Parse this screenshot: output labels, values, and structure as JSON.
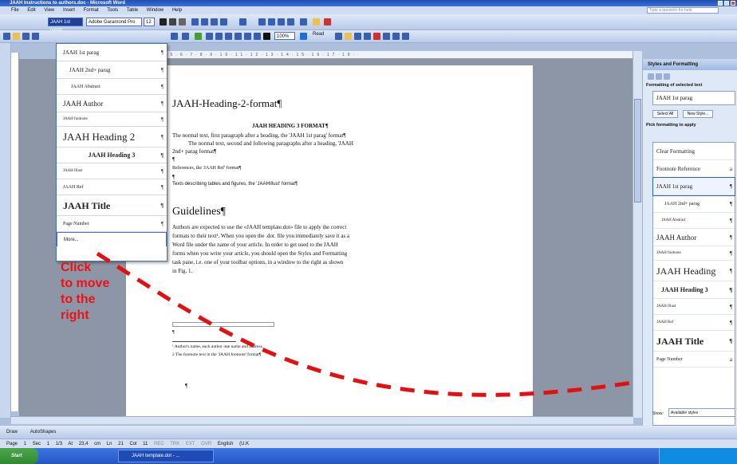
{
  "window": {
    "title": "JAAH Instructions to authors.doc - Microsoft Word"
  },
  "menu": {
    "items": [
      "File",
      "Edit",
      "View",
      "Insert",
      "Format",
      "Tools",
      "Table",
      "Window",
      "Help"
    ],
    "question_placeholder": "Type a question for help"
  },
  "toolbar": {
    "style_value": "JAAH 1st parag",
    "font_value": "Adobe Garamond Pro",
    "size_value": "12",
    "zoom_value": "100%",
    "read_label": "Read"
  },
  "dropdown": {
    "items": [
      {
        "label": "JAAH 1st parag"
      },
      {
        "label": "JAAH 2nd+ parag"
      },
      {
        "label": "JAAH Abstract"
      },
      {
        "label": "JAAH Author"
      },
      {
        "label": "JAAH footnote"
      },
      {
        "label": "JAAH Heading 2"
      },
      {
        "label": "JAAH Heading 3"
      },
      {
        "label": "JAAH Illust"
      },
      {
        "label": "JAAH Ref"
      },
      {
        "label": "JAAH Title"
      },
      {
        "label": "Page Number"
      },
      {
        "label": "More..."
      }
    ]
  },
  "document": {
    "heading2": "JAAH-Heading-2-format¶",
    "heading3": "JAAH HEADING 3 FORMAT¶",
    "p1": "The normal text, first paragraph after a heading, the 'JAAH 1st parag' format¶",
    "p2a": "The normal text, second and following paragraphs after a heading, 'JAAH",
    "p2b": "2nd+ parag format¶",
    "pilcrow": "¶",
    "ref_line": "References, the 'JAAH Ref' format¶",
    "illust_line": "Texts describing tables and figures, the 'JAAHIllust' format¶",
    "guidelines": "Guidelines¶",
    "g1": "Authors are expected to use the «JAAH template.dot» file to apply the correct",
    "g2": "formats to their text¹. When you open the .dot. file you immediately save it as a",
    "g3": "Word file under the name of your article. In order to get used to the JAAH",
    "g4": "forms when you write your article, you should open the Styles and Formatting",
    "g5": "task pane, i.e. one of your toolbar options, in a window to the right as shown",
    "g6": "in Fig. 1.",
    "fn1": "¹ Author's name, each author one name and address",
    "fn2": "2 The footnote text in the 'JAAH footnote' format¶"
  },
  "annotation": {
    "lines": [
      "Click",
      "to move",
      "to the",
      "right"
    ]
  },
  "task_pane": {
    "title": "Styles and Formatting",
    "selected_label": "Formatting of selected text",
    "selected_value": "JAAH 1st parag",
    "select_all": "Select All",
    "new_style": "New Style...",
    "pick_label": "Pick formatting to apply",
    "items": [
      {
        "label": "Clear Formatting"
      },
      {
        "label": "Footnote Reference"
      },
      {
        "label": "JAAH 1st parag"
      },
      {
        "label": "JAAH 2nd+ parag"
      },
      {
        "label": "JAAH Abstract"
      },
      {
        "label": "JAAH Author"
      },
      {
        "label": "JAAH footnote"
      },
      {
        "label": "JAAH Heading"
      },
      {
        "label": "JAAH Heading 3"
      },
      {
        "label": "JAAH Illust"
      },
      {
        "label": "JAAH Ref"
      },
      {
        "label": "JAAH Title"
      },
      {
        "label": "Page Number"
      }
    ],
    "show_label": "Show:",
    "show_value": "Available styles"
  },
  "drawbar": {
    "draw_label": "Draw",
    "autoshapes_label": "AutoShapes"
  },
  "status": {
    "page": "Page 1",
    "sec": "Sec 1",
    "pages": "1/3",
    "at": "At 23,4 cm",
    "ln": "Ln 21",
    "col": "Col 11",
    "flags": "REC TRK EXT OVR",
    "lang": "English (U.K"
  },
  "taskbar": {
    "start": "Start",
    "task": "JAAH template.dot - ..."
  },
  "colors": {
    "accent": "#2f5fc4",
    "annotation": "#e11111"
  }
}
